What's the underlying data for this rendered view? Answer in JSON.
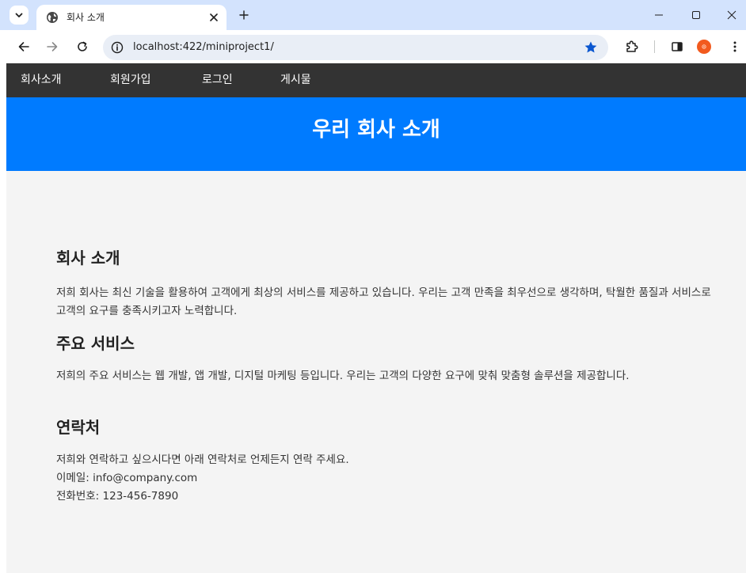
{
  "browser": {
    "tab_title": "회사 소개",
    "url": "localhost:422/miniproject1/"
  },
  "nav": {
    "items": [
      "회사소개",
      "회원가입",
      "로그인",
      "게시물"
    ]
  },
  "hero": {
    "title": "우리 회사 소개"
  },
  "sections": {
    "about": {
      "title": "회사 소개",
      "text": "저희 회사는 최신 기술을 활용하여 고객에게 최상의 서비스를 제공하고 있습니다. 우리는 고객 만족을 최우선으로 생각하며, 탁월한 품질과 서비스로 고객의 요구를 충족시키고자 노력합니다."
    },
    "services": {
      "title": "주요 서비스",
      "text": "저희의 주요 서비스는 웹 개발, 앱 개발, 디지털 마케팅 등입니다. 우리는 고객의 다양한 요구에 맞춰 맞춤형 솔루션을 제공합니다."
    },
    "contact": {
      "title": "연락처",
      "intro": "저희와 연락하고 싶으시다면 아래 연락처로 언제든지 연락 주세요.",
      "email": "이메일: info@company.com",
      "phone": "전화번호: 123-456-7890"
    }
  },
  "colors": {
    "nav_bg": "#333333",
    "hero_bg": "#007bff",
    "page_bg": "#f4f4f4",
    "tabstrip_bg": "#d3e3fd",
    "star": "#0b57d0",
    "profile": "#f25a1e"
  }
}
